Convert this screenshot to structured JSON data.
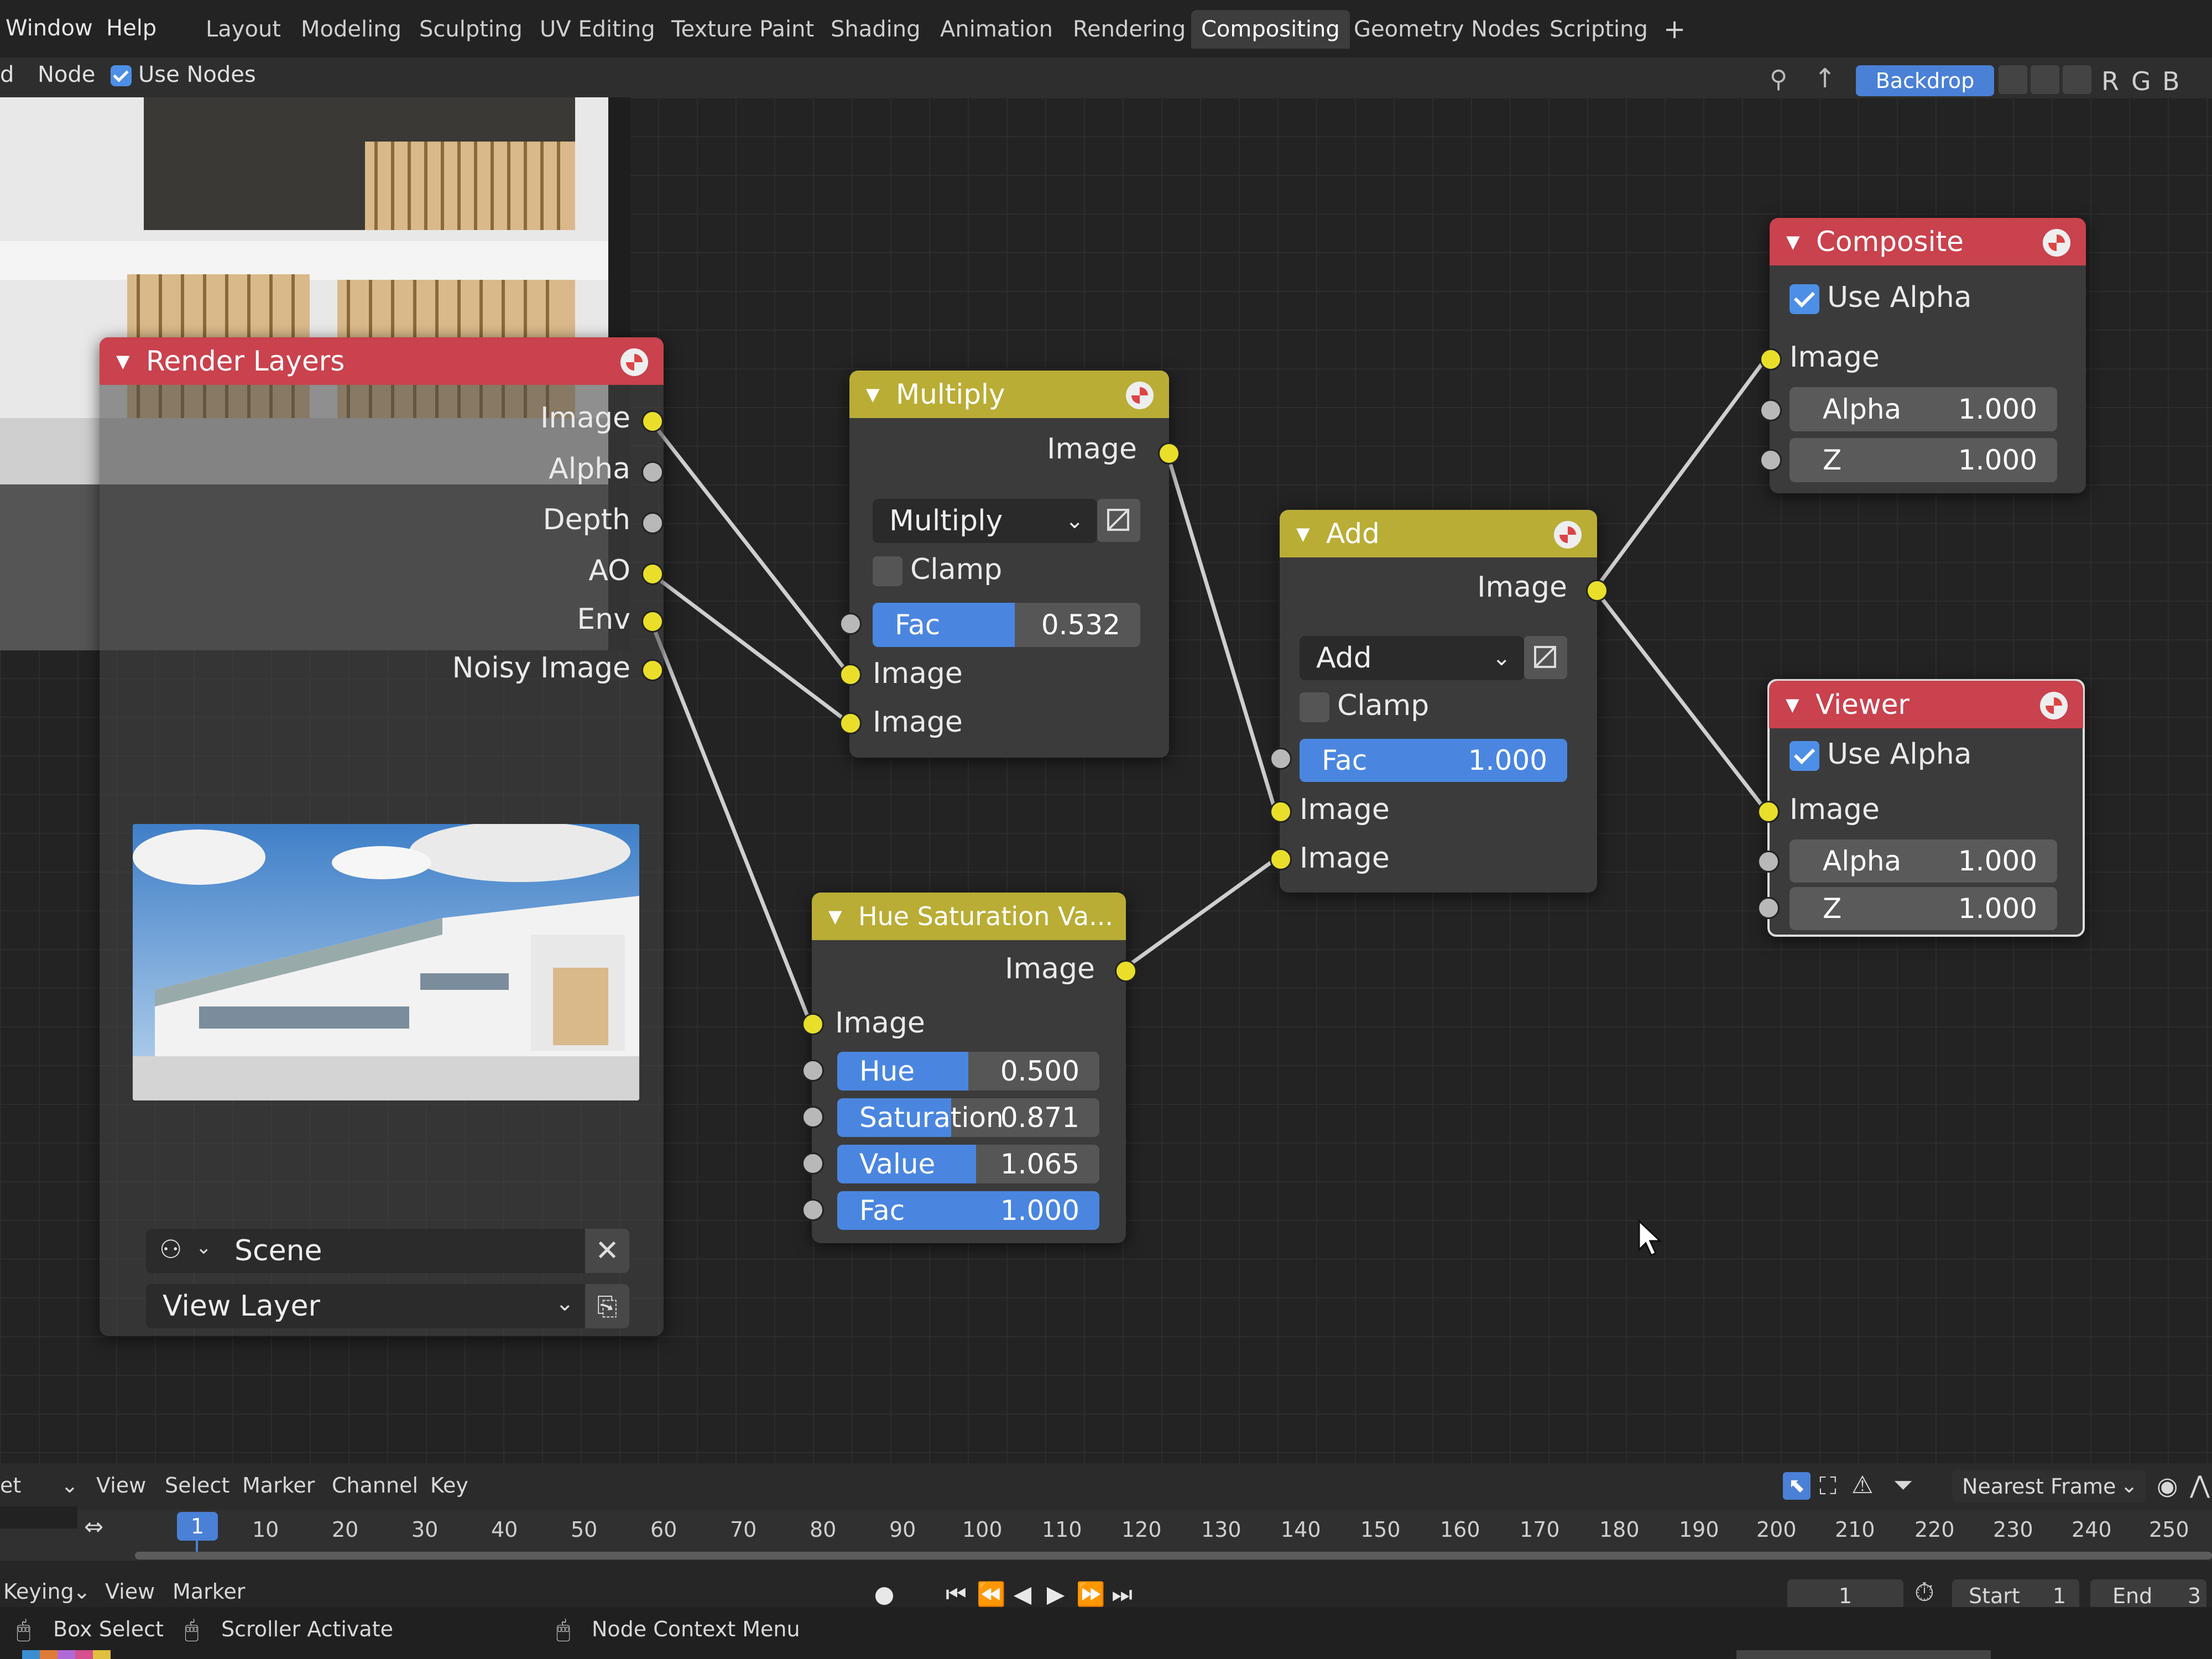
{
  "topbar": {
    "menus": [
      "Window",
      "Help"
    ],
    "workspaces": [
      "Layout",
      "Modeling",
      "Sculpting",
      "UV Editing",
      "Texture Paint",
      "Shading",
      "Animation",
      "Rendering",
      "Compositing",
      "Geometry Nodes",
      "Scripting"
    ],
    "active_workspace": "Compositing",
    "add_workspace": "+"
  },
  "header": {
    "partial_left": "d",
    "node_menu": "Node",
    "use_nodes_label": "Use Nodes",
    "use_nodes_checked": true,
    "backdrop_label": "Backdrop",
    "channels": [
      "R",
      "G",
      "B"
    ]
  },
  "nodes": {
    "render_layers": {
      "title": "Render Layers",
      "outputs": [
        "Image",
        "Alpha",
        "Depth",
        "AO",
        "Env",
        "Noisy Image"
      ],
      "scene": "Scene",
      "view_layer": "View Layer"
    },
    "multiply": {
      "title": "Multiply",
      "output": "Image",
      "blend": "Multiply",
      "clamp_label": "Clamp",
      "clamp": false,
      "fac_label": "Fac",
      "fac": "0.532",
      "fac_fraction": 0.532,
      "inputs": [
        "Image",
        "Image"
      ]
    },
    "add": {
      "title": "Add",
      "output": "Image",
      "blend": "Add",
      "clamp_label": "Clamp",
      "clamp": false,
      "fac_label": "Fac",
      "fac": "1.000",
      "fac_fraction": 1.0,
      "inputs": [
        "Image",
        "Image"
      ]
    },
    "hsv": {
      "title": "Hue Saturation Va...",
      "output": "Image",
      "input": "Image",
      "fields": [
        {
          "label": "Hue",
          "value": "0.500",
          "fraction": 0.5
        },
        {
          "label": "Saturation",
          "value": "0.871",
          "fraction": 0.435
        },
        {
          "label": "Value",
          "value": "1.065",
          "fraction": 0.53
        },
        {
          "label": "Fac",
          "value": "1.000",
          "fraction": 1.0
        }
      ]
    },
    "composite": {
      "title": "Composite",
      "use_alpha_label": "Use Alpha",
      "use_alpha": true,
      "input": "Image",
      "alpha_label": "Alpha",
      "alpha": "1.000",
      "z_label": "Z",
      "z": "1.000"
    },
    "viewer": {
      "title": "Viewer",
      "use_alpha_label": "Use Alpha",
      "use_alpha": true,
      "input": "Image",
      "alpha_label": "Alpha",
      "alpha": "1.000",
      "z_label": "Z",
      "z": "1.000"
    }
  },
  "timeline": {
    "partial_left": "et",
    "menus": [
      "View",
      "Select",
      "Marker",
      "Channel",
      "Key"
    ],
    "interpolation": "Nearest Frame",
    "current_frame_marker": "1",
    "ticks": [
      "10",
      "20",
      "30",
      "40",
      "50",
      "60",
      "70",
      "80",
      "90",
      "100",
      "110",
      "120",
      "130",
      "140",
      "150",
      "160",
      "170",
      "180",
      "190",
      "200",
      "210",
      "220",
      "230",
      "240",
      "250"
    ],
    "keying": "Keying",
    "bottom_menus": [
      "View",
      "Marker"
    ],
    "current_frame": "1",
    "start_label": "Start",
    "start": "1",
    "end_label": "End",
    "end": "3"
  },
  "statusbar": {
    "box_select": "Box Select",
    "scroller": "Scroller Activate",
    "context_menu": "Node Context Menu"
  },
  "colors": {
    "output_header": "#c9424d",
    "mix_header": "#b9ad36",
    "accent": "#4a86e0",
    "socket_color": "#e9df2a",
    "socket_value": "#b8b8b8"
  }
}
